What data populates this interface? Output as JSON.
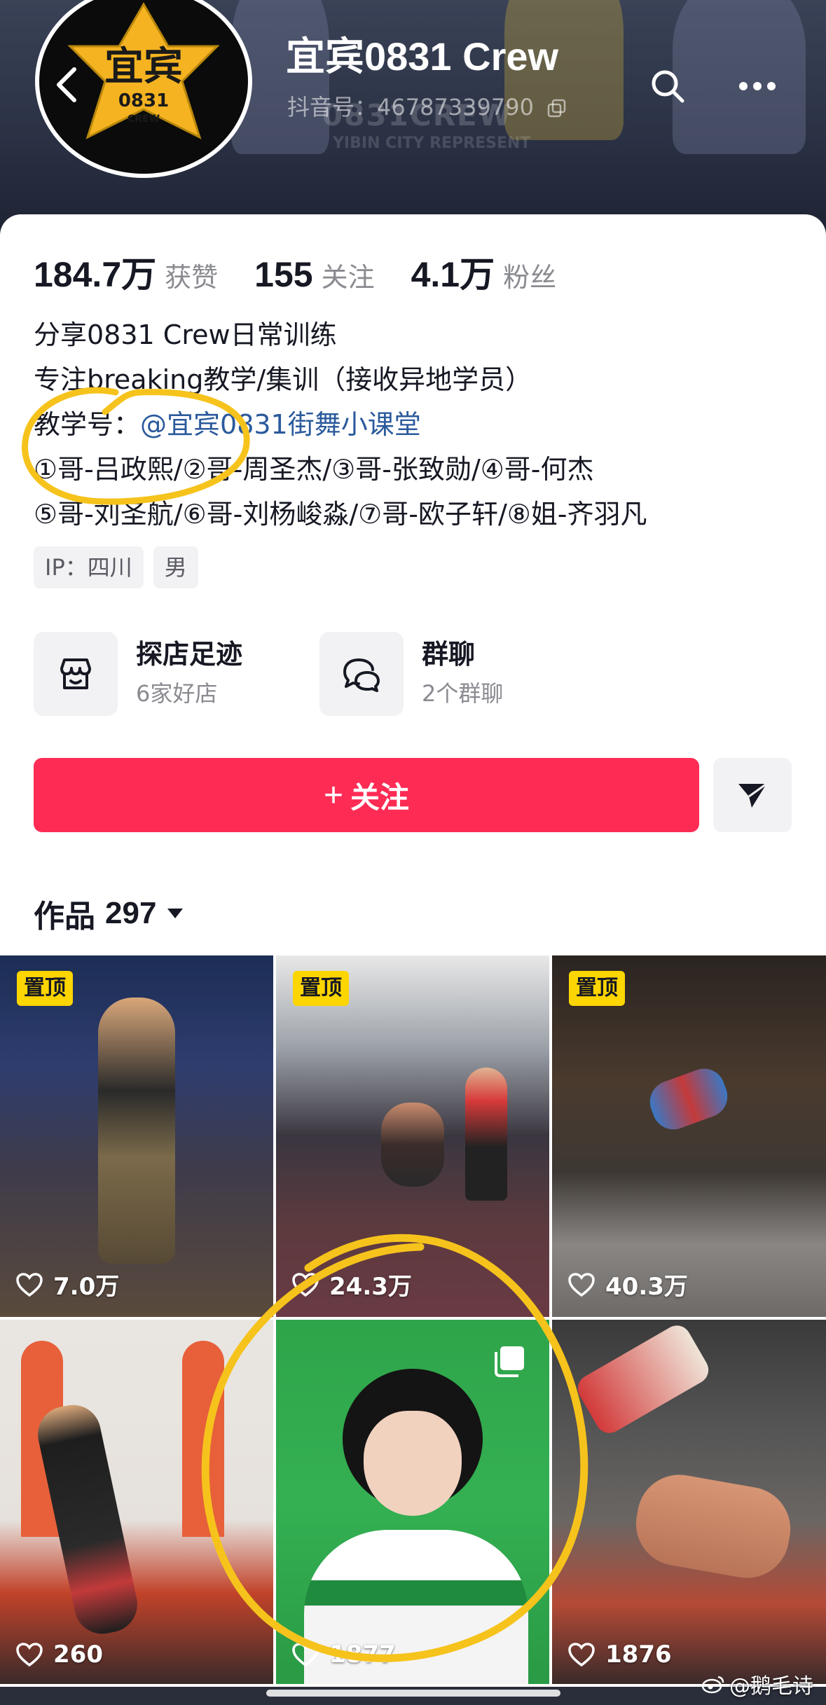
{
  "header": {
    "title": "宜宾0831 Crew",
    "douyin_id": "抖音号：46787339790",
    "banner_text": "0831CREW",
    "banner_subtext": "YIBIN CITY REPRESENT",
    "avatar_text": "宜宾",
    "avatar_sub": "0831",
    "avatar_crew": "CREW",
    "back_icon": "chevron-left-icon",
    "search_icon": "search-icon",
    "more_icon": "more-dots-icon"
  },
  "stats": [
    {
      "value": "184.7万",
      "label": "获赞"
    },
    {
      "value": "155",
      "label": "关注"
    },
    {
      "value": "4.1万",
      "label": "粉丝"
    }
  ],
  "bio": {
    "line1": "分享0831 Crew日常训练",
    "line2": "专注breaking教学/集训（接收异地学员）",
    "line3_prefix": "教学号：",
    "line3_mention": "@宜宾0831街舞小课堂",
    "line4": "①哥-吕政熙/②哥-周圣杰/③哥-张致勋/④哥-何杰",
    "line5": "⑤哥-刘圣航/⑥哥-刘杨峻淼/⑦哥-欧子轩/⑧姐-齐羽凡"
  },
  "tags": [
    "IP：四川",
    "男"
  ],
  "services": [
    {
      "title": "探店足迹",
      "sub": "6家好店",
      "icon": "store-icon"
    },
    {
      "title": "群聊",
      "sub": "2个群聊",
      "icon": "chat-icon"
    }
  ],
  "actions": {
    "follow_plus": "+",
    "follow_label": "关注",
    "share_icon": "send-icon"
  },
  "works": {
    "label": "作品",
    "count": "297"
  },
  "grid": [
    {
      "pinned": true,
      "pin_label": "置顶",
      "likes": "7.0万"
    },
    {
      "pinned": true,
      "pin_label": "置顶",
      "likes": "24.3万"
    },
    {
      "pinned": true,
      "pin_label": "置顶",
      "likes": "40.3万"
    },
    {
      "pinned": false,
      "likes": "260"
    },
    {
      "pinned": false,
      "likes": "1877",
      "multi_image": true
    },
    {
      "pinned": false,
      "likes": "1876"
    }
  ],
  "watermark": "@鹅毛诗",
  "colors": {
    "accent": "#fe2c55",
    "pin": "#fdd500",
    "mention": "#2b5a9c",
    "annotation": "#f6c31c"
  }
}
